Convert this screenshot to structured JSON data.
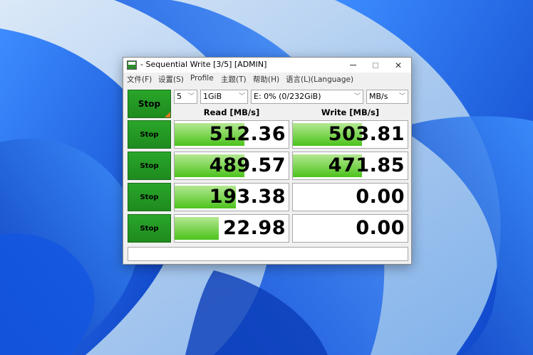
{
  "window": {
    "title": "- Sequential Write [3/5] [ADMIN]",
    "close_glyph": "✕"
  },
  "menu": [
    "文件(F)",
    "设置(S)",
    "Profile",
    "主题(T)",
    "帮助(H)",
    "语言(L)(Language)"
  ],
  "controls": {
    "start_label": "Stop",
    "count": "5",
    "size": "1GiB",
    "drive": "E: 0% (0/232GiB)",
    "unit": "MB/s"
  },
  "headers": {
    "read": "Read [MB/s]",
    "write": "Write [MB/s]"
  },
  "rows": [
    {
      "label": "Stop",
      "read": "512.36",
      "write": "503.81",
      "read_fill": 0.61,
      "write_fill": 0.6
    },
    {
      "label": "Stop",
      "read": "489.57",
      "write": "471.85",
      "read_fill": 0.61,
      "write_fill": 0.6
    },
    {
      "label": "Stop",
      "read": "193.38",
      "write": "0.00",
      "read_fill": 0.54,
      "write_fill": 0.0
    },
    {
      "label": "Stop",
      "read": "22.98",
      "write": "0.00",
      "read_fill": 0.39,
      "write_fill": 0.0
    }
  ],
  "status": "",
  "colors": {
    "accent_green": "#2aa62a",
    "bar_green": "#4cc31c",
    "wallpaper_blue": "#1b5fe0"
  }
}
